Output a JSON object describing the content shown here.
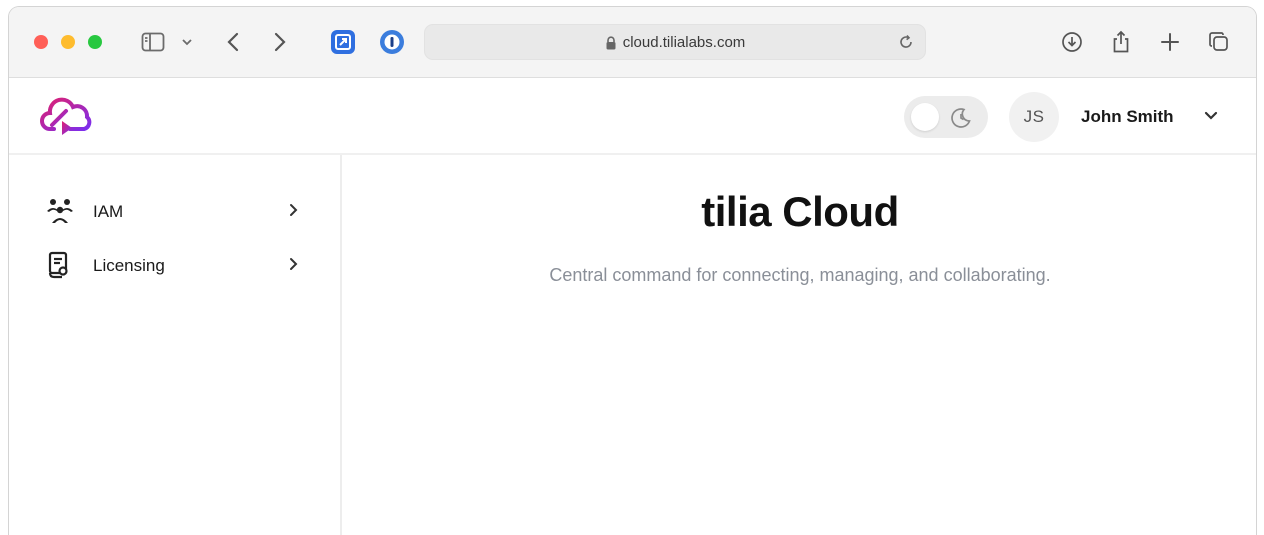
{
  "browser": {
    "url": "cloud.tilialabs.com"
  },
  "header": {
    "user_initials": "JS",
    "user_name": "John Smith"
  },
  "sidebar": {
    "items": [
      {
        "label": "IAM",
        "icon": "users-icon"
      },
      {
        "label": "Licensing",
        "icon": "license-icon"
      }
    ]
  },
  "main": {
    "title": "tilia Cloud",
    "subtitle": "Central command for connecting, managing, and collaborating."
  },
  "colors": {
    "brand_gradient_start": "#e0206f",
    "brand_gradient_end": "#7a2ef0",
    "traffic_red": "#ff5f57",
    "traffic_yellow": "#febc2e",
    "traffic_green": "#28c840",
    "subtitle_gray": "#8a8f98"
  }
}
